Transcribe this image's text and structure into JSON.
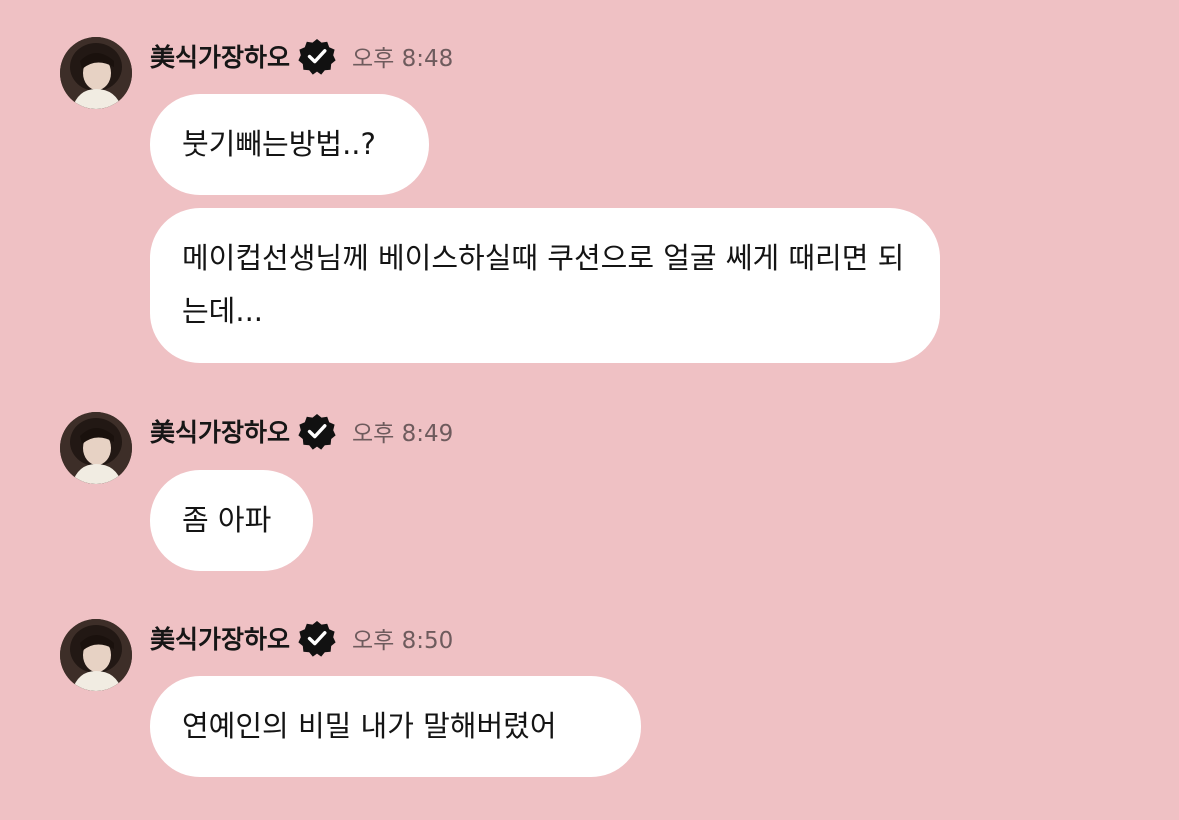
{
  "app": {
    "background_color": "#efc1c4",
    "bubble_color": "#ffffff",
    "verified_color": "#111111"
  },
  "messages": [
    {
      "sender": "美식가장하오",
      "time": "오후 8:48",
      "verified_icon": "verified-badge-icon",
      "bubbles": [
        "붓기빼는방법..?",
        "메이컵선생님께 베이스하실때 쿠션으로 얼굴 쎄게 때리면 되는데..."
      ]
    },
    {
      "sender": "美식가장하오",
      "time": "오후 8:49",
      "verified_icon": "verified-badge-icon",
      "bubbles": [
        "좀 아파"
      ]
    },
    {
      "sender": "美식가장하오",
      "time": "오후 8:50",
      "verified_icon": "verified-badge-icon",
      "bubbles": [
        "연예인의 비밀 내가 말해버렸어"
      ]
    }
  ]
}
